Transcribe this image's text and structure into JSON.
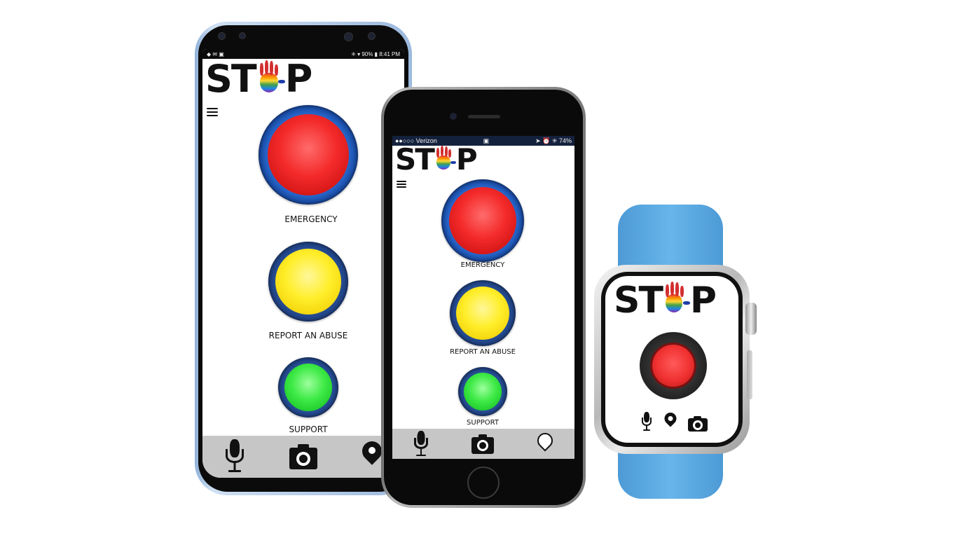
{
  "android": {
    "status_time": "8:41 PM",
    "status_icons": "◆ ✉ ▣",
    "status_right": "✳ ▾ 90% ▮",
    "logo_left": "ST",
    "logo_right": "P",
    "buttons": [
      {
        "label": "EMERGENCY",
        "color": "#f42a2a"
      },
      {
        "label": "REPORT AN ABUSE",
        "color": "#ffee2a"
      },
      {
        "label": "SUPPORT",
        "color": "#3eea46"
      }
    ],
    "bottom_icons": [
      "microphone-icon",
      "camera-icon",
      "location-pin-icon"
    ]
  },
  "iphone": {
    "carrier": "●●○○○ Verizon",
    "lock": "▣",
    "battery": "74%",
    "status_right_icons": "➤ ⏰ ✳",
    "logo_left": "ST",
    "logo_right": "P",
    "buttons": [
      {
        "label": "EMERGENCY",
        "color": "#f42a2a"
      },
      {
        "label": "REPORT AN ABUSE",
        "color": "#ffee2a"
      },
      {
        "label": "SUPPORT",
        "color": "#3eea46"
      }
    ],
    "bottom_icons": [
      "microphone-icon",
      "camera-icon",
      "location-pin-icon"
    ]
  },
  "watch": {
    "logo_left": "ST",
    "logo_right": "P",
    "button_color": "#f03030",
    "band_color": "#5aa8e0",
    "bottom_icons": [
      "microphone-icon",
      "location-pin-icon",
      "camera-icon"
    ]
  }
}
